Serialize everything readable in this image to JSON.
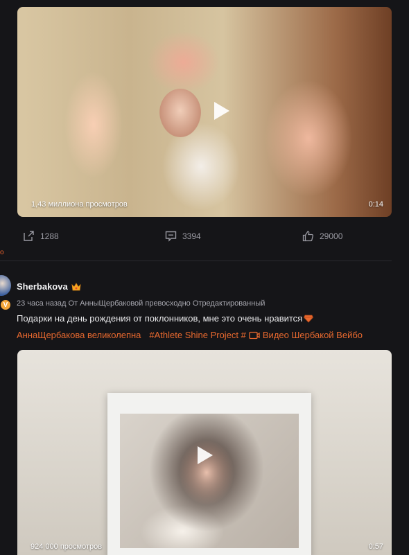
{
  "post1": {
    "video": {
      "views": "1,43 миллиона просмотров",
      "duration": "0:14"
    },
    "actions": {
      "repost_count": "1288",
      "comment_count": "3394",
      "like_count": "29000"
    }
  },
  "post2": {
    "username": "Sherbakova",
    "meta": "23 часа назад  От АнныЩербаковой превосходно Отредактированный",
    "text": "Подарки на день рождения от поклонников, мне это очень нравится",
    "tags": {
      "tag1": "АннаЩербакова великолепна",
      "tag2": "#Athlete Shine Project #",
      "tag3": "Видео Шербакой Вейбо"
    },
    "video": {
      "views": "924 000 просмотров",
      "duration": "0:57"
    }
  },
  "stub_text": "о",
  "colors": {
    "background": "#151518",
    "accent": "#e8692f",
    "muted": "#9a9aa2"
  }
}
